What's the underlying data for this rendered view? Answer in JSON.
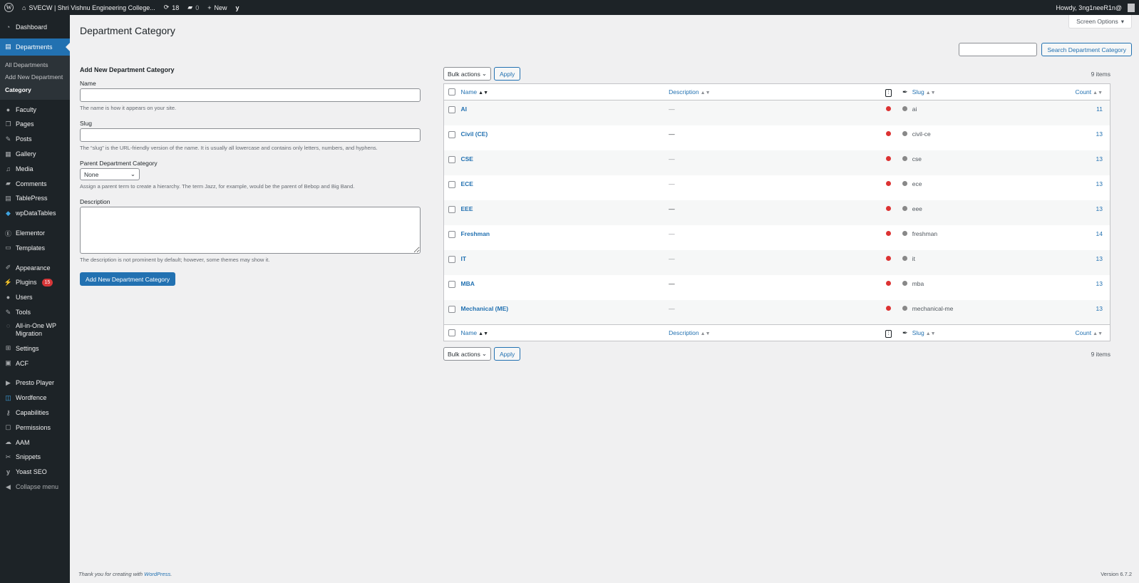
{
  "adminbar": {
    "site_name": "SVECW | Shri Vishnu Engineering College...",
    "updates_count": "18",
    "comments_count": "0",
    "new_label": "New",
    "howdy": "Howdy, 3ng1neeR1n@"
  },
  "sidebar": {
    "items": [
      {
        "label": "Dashboard",
        "icon": "dashboard-icon"
      },
      {
        "label": "Departments",
        "icon": "departments-icon"
      },
      {
        "label": "Faculty",
        "icon": "user-icon"
      },
      {
        "label": "Pages",
        "icon": "pages-icon"
      },
      {
        "label": "Posts",
        "icon": "pin-icon"
      },
      {
        "label": "Gallery",
        "icon": "gallery-icon"
      },
      {
        "label": "Media",
        "icon": "media-icon"
      },
      {
        "label": "Comments",
        "icon": "comment-icon"
      },
      {
        "label": "TablePress",
        "icon": "table-icon"
      },
      {
        "label": "wpDataTables",
        "icon": "wpdatatables-icon"
      },
      {
        "label": "Elementor",
        "icon": "elementor-icon"
      },
      {
        "label": "Templates",
        "icon": "folder-icon"
      },
      {
        "label": "Appearance",
        "icon": "brush-icon"
      },
      {
        "label": "Plugins",
        "icon": "plugin-icon",
        "badge": "15"
      },
      {
        "label": "Users",
        "icon": "users-icon"
      },
      {
        "label": "Tools",
        "icon": "wrench-icon"
      },
      {
        "label": "All-in-One WP Migration",
        "icon": "migration-icon"
      },
      {
        "label": "Settings",
        "icon": "settings-icon"
      },
      {
        "label": "ACF",
        "icon": "acf-icon"
      },
      {
        "label": "Presto Player",
        "icon": "player-icon"
      },
      {
        "label": "Wordfence",
        "icon": "wordfence-icon"
      },
      {
        "label": "Capabilities",
        "icon": "key-icon"
      },
      {
        "label": "Permissions",
        "icon": "lock-icon"
      },
      {
        "label": "AAM",
        "icon": "aam-icon"
      },
      {
        "label": "Snippets",
        "icon": "scissors-icon"
      },
      {
        "label": "Yoast SEO",
        "icon": "yoast-icon"
      },
      {
        "label": "Collapse menu",
        "icon": "collapse-icon"
      }
    ],
    "submenu": [
      "All Departments",
      "Add New Department",
      "Category"
    ]
  },
  "page": {
    "title": "Department Category",
    "screen_options": "Screen Options",
    "search_button": "Search Department Category"
  },
  "form": {
    "heading": "Add New Department Category",
    "name_label": "Name",
    "name_help": "The name is how it appears on your site.",
    "slug_label": "Slug",
    "slug_help": "The “slug” is the URL-friendly version of the name. It is usually all lowercase and contains only letters, numbers, and hyphens.",
    "parent_label": "Parent Department Category",
    "parent_value": "None",
    "parent_help": "Assign a parent term to create a hierarchy. The term Jazz, for example, would be the parent of Bebop and Big Band.",
    "desc_label": "Description",
    "desc_help": "The description is not prominent by default; however, some themes may show it.",
    "submit": "Add New Department Category"
  },
  "table": {
    "bulk_actions": "Bulk actions",
    "apply": "Apply",
    "items_count": "9 items",
    "columns": {
      "name": "Name",
      "description": "Description",
      "slug": "Slug",
      "count": "Count"
    },
    "rows": [
      {
        "name": "AI",
        "description": "—",
        "slug": "ai",
        "count": "11"
      },
      {
        "name": "Civil (CE)",
        "description": "—",
        "slug": "civil-ce",
        "count": "13"
      },
      {
        "name": "CSE",
        "description": "—",
        "slug": "cse",
        "count": "13"
      },
      {
        "name": "ECE",
        "description": "—",
        "slug": "ece",
        "count": "13"
      },
      {
        "name": "EEE",
        "description": "—",
        "slug": "eee",
        "count": "13"
      },
      {
        "name": "Freshman",
        "description": "—",
        "slug": "freshman",
        "count": "14"
      },
      {
        "name": "IT",
        "description": "—",
        "slug": "it",
        "count": "13"
      },
      {
        "name": "MBA",
        "description": "—",
        "slug": "mba",
        "count": "13"
      },
      {
        "name": "Mechanical (ME)",
        "description": "—",
        "slug": "mechanical-me",
        "count": "13"
      }
    ]
  },
  "footer": {
    "thanks_prefix": "Thank you for creating with ",
    "wordpress_link": "WordPress",
    "thanks_suffix": ".",
    "version": "Version 6.7.2"
  }
}
